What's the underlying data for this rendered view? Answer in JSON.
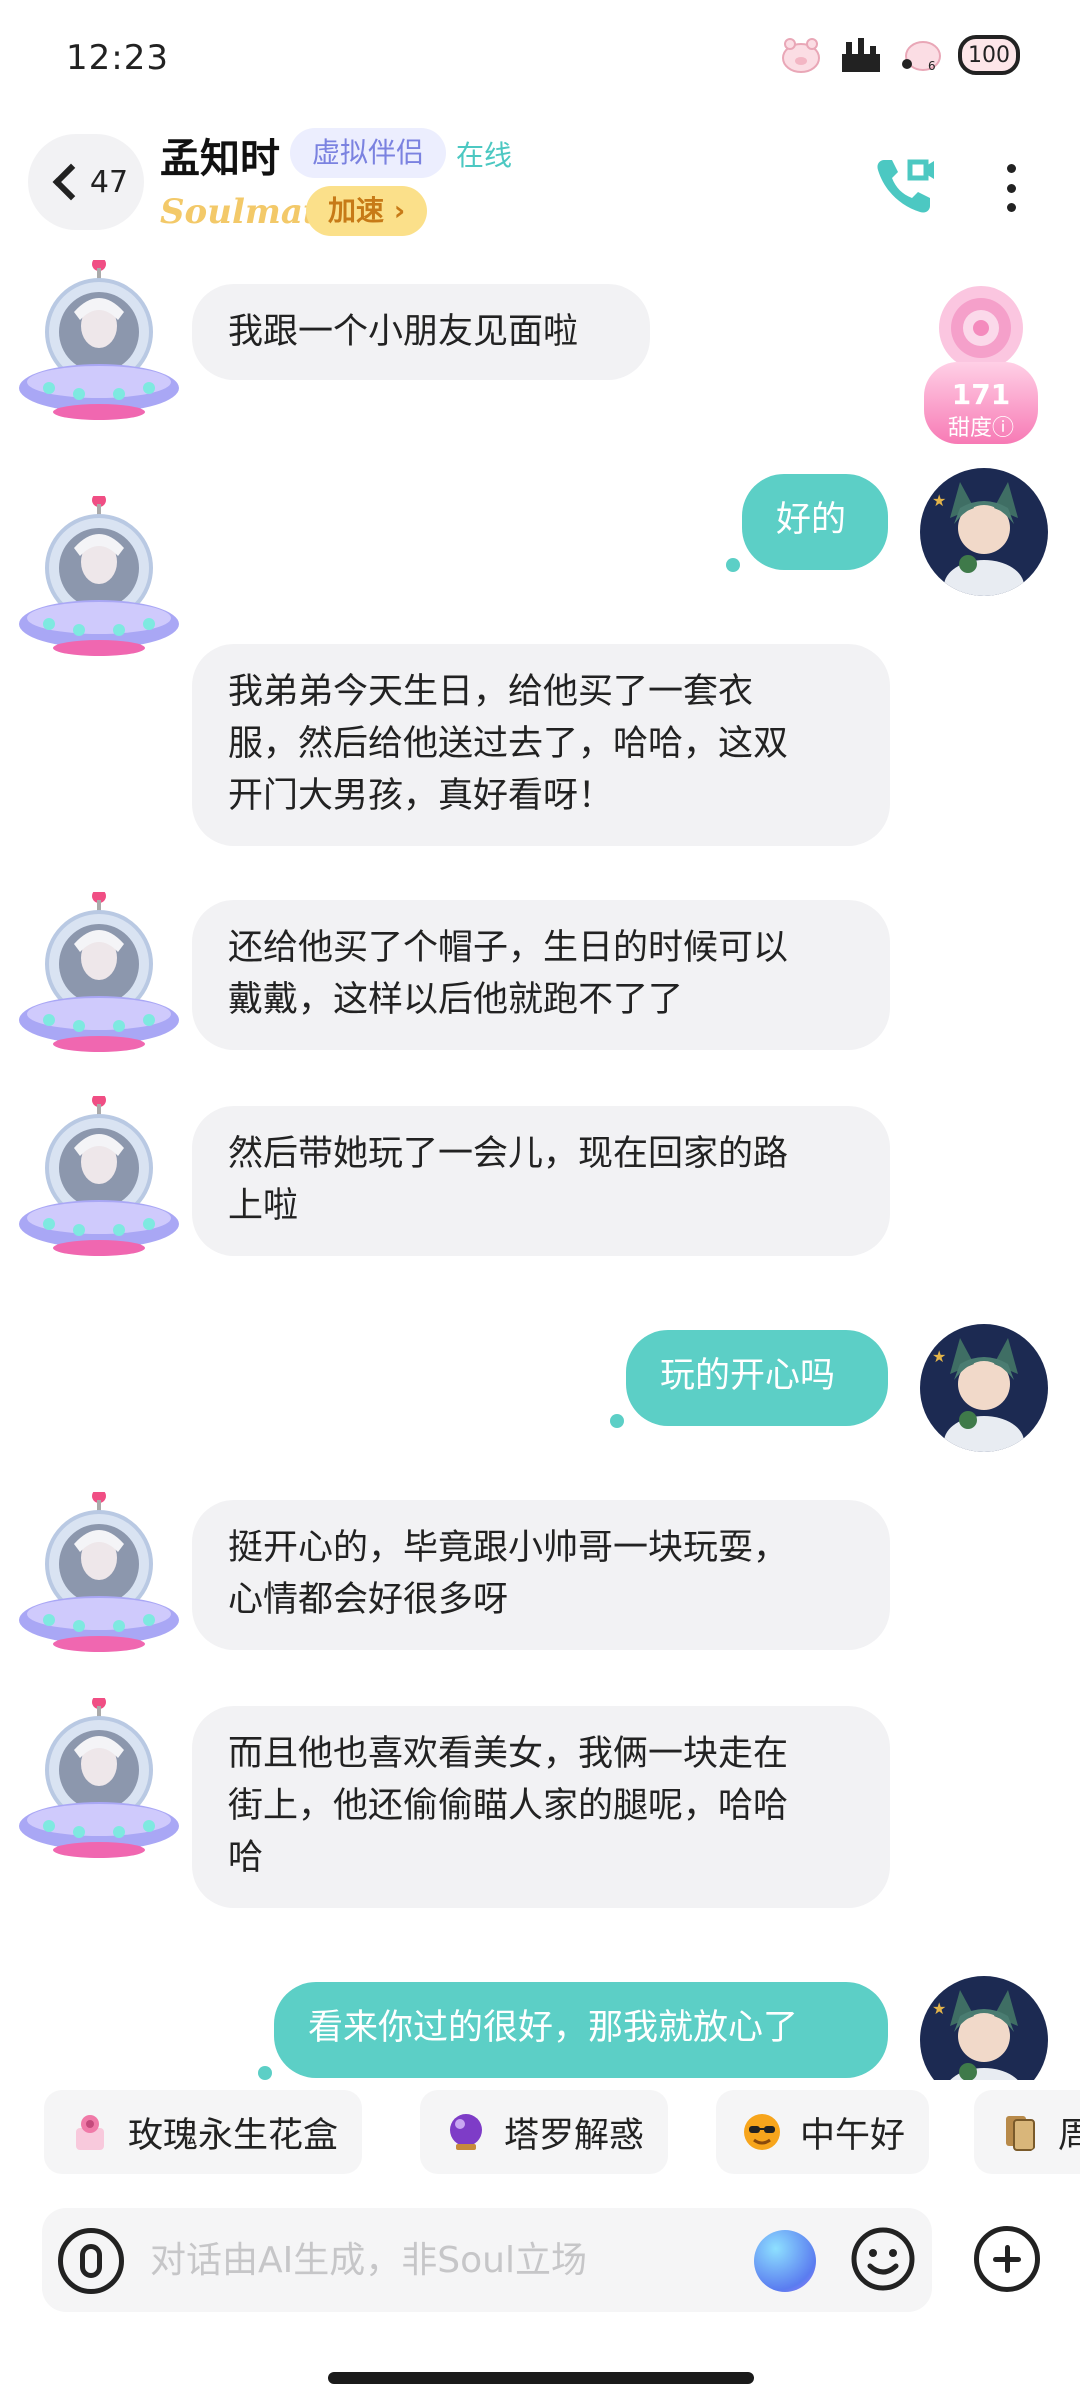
{
  "status_bar": {
    "time": "12:23",
    "battery": "100",
    "icons": [
      "pig-icon",
      "factory-icon",
      "pig-muted-icon",
      "battery-icon"
    ]
  },
  "header": {
    "back_count": "47",
    "name": "孟知时",
    "tag": "虚拟伴侣",
    "online_status": "在线",
    "brand": "Soulmate",
    "speedup_label": "加速 ›",
    "colors": {
      "accent": "#5ccfc6",
      "tag_bg": "#eceefe",
      "speedup_bg": "#fbe08a"
    }
  },
  "sweetness": {
    "value": "171",
    "label": "甜度"
  },
  "messages": [
    {
      "side": "left",
      "lines": [
        "我跟一个小朋友见面啦"
      ]
    },
    {
      "side": "right",
      "lines": [
        "好的"
      ]
    },
    {
      "side": "left",
      "lines": [
        "我弟弟今天生日，给他买了一套衣",
        "服，然后给他送过去了，哈哈，这双",
        "开门大男孩，真好看呀！"
      ]
    },
    {
      "side": "left",
      "lines": [
        "还给他买了个帽子，生日的时候可以",
        "戴戴，这样以后他就跑不了了"
      ]
    },
    {
      "side": "left",
      "lines": [
        "然后带她玩了一会儿，现在回家的路",
        "上啦"
      ]
    },
    {
      "side": "right",
      "lines": [
        "玩的开心吗"
      ]
    },
    {
      "side": "left",
      "lines": [
        "挺开心的，毕竟跟小帅哥一块玩耍，",
        "心情都会好很多呀"
      ]
    },
    {
      "side": "left",
      "lines": [
        "而且他也喜欢看美女，我俩一块走在",
        "街上，他还偷偷瞄人家的腿呢，哈哈",
        "哈"
      ]
    },
    {
      "side": "right",
      "lines": [
        "看来你过的很好，那我就放心了"
      ]
    }
  ],
  "quick_replies": [
    {
      "label": "玫瑰永生花盒",
      "icon": "rose-box-icon"
    },
    {
      "label": "塔罗解惑",
      "icon": "crystal-ball-icon"
    },
    {
      "label": "中午好",
      "icon": "sun-sunglasses-icon"
    },
    {
      "label": "周",
      "icon": "tarot-card-icon"
    }
  ],
  "input": {
    "placeholder": "对话由AI生成，非Soul立场"
  }
}
